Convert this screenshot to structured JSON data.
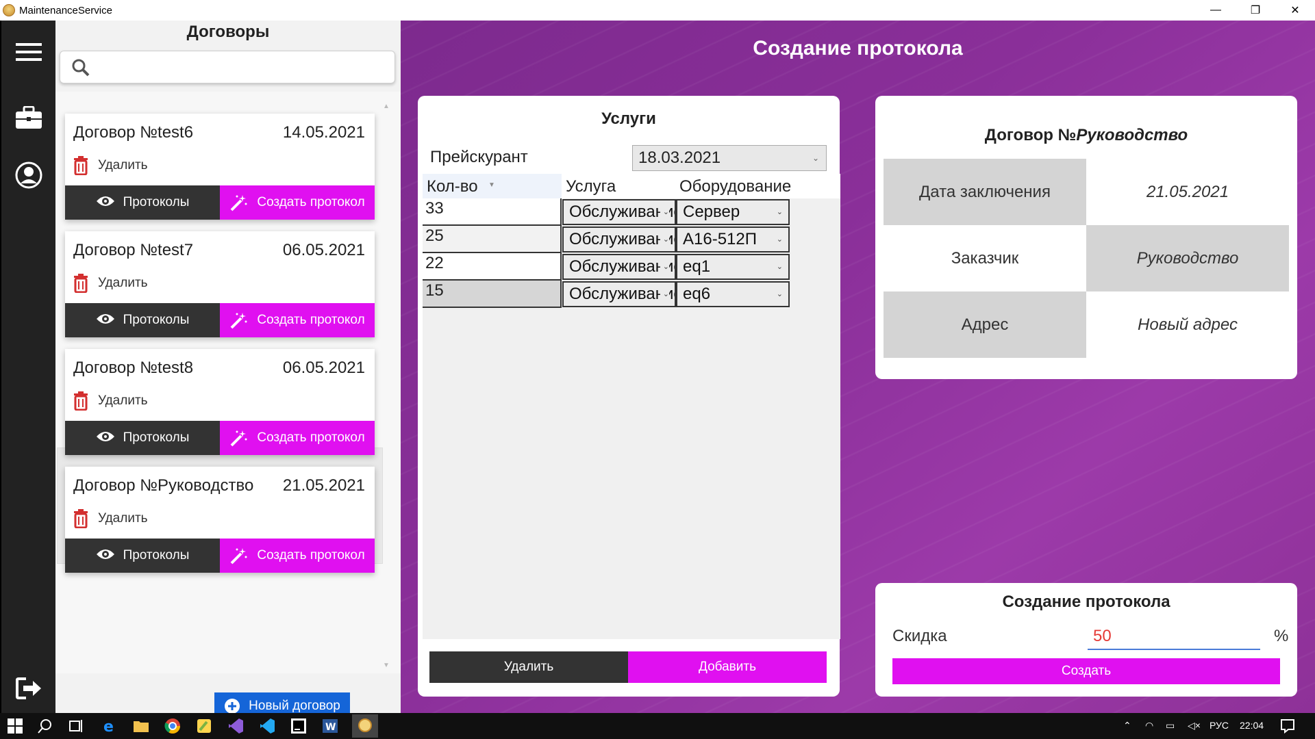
{
  "window": {
    "title": "MaintenanceService",
    "minimize": "—",
    "restore": "❐",
    "close": "✕"
  },
  "sidebar": {
    "menu_icon": "hamburger-icon",
    "briefcase_icon": "briefcase-icon",
    "user_icon": "user-icon",
    "logout_icon": "logout-icon"
  },
  "contracts": {
    "title": "Договоры",
    "search": {
      "value": "",
      "placeholder": ""
    },
    "delete_label": "Удалить",
    "protocols_label": "Протоколы",
    "create_protocol_label": "Создать протокол",
    "items": [
      {
        "title": "Договор №test6",
        "date": "14.05.2021"
      },
      {
        "title": "Договор №test7",
        "date": "06.05.2021"
      },
      {
        "title": "Договор №test8",
        "date": "06.05.2021"
      },
      {
        "title": "Договор №Руководство",
        "date": "21.05.2021"
      }
    ],
    "new_contract_label": "Новый договор"
  },
  "main": {
    "title": "Создание протокола",
    "services": {
      "title": "Услуги",
      "price_list_label": "Прейскурант",
      "price_list_value": "18.03.2021",
      "columns": [
        "Кол-во",
        "Услуга",
        "Оборудование"
      ],
      "rows": [
        {
          "qty": "33",
          "service": "Обслуживание",
          "equipment": "Сервер"
        },
        {
          "qty": "25",
          "service": "Обслуживание",
          "equipment": "А16-512П"
        },
        {
          "qty": "22",
          "service": "Обслуживание",
          "equipment": "eq1"
        },
        {
          "qty": "15",
          "service": "Обслуживание",
          "equipment": "eq6"
        }
      ],
      "delete_label": "Удалить",
      "add_label": "Добавить"
    },
    "contract_info": {
      "title_prefix": "Договор №",
      "title_name": "Руководство",
      "date_label": "Дата заключения",
      "date_value": "21.05.2021",
      "customer_label": "Заказчик",
      "customer_value": "Руководство",
      "address_label": "Адрес",
      "address_value": "Новый адрес"
    },
    "create_protocol": {
      "title": "Создание протокола",
      "discount_label": "Скидка",
      "discount_value": "50",
      "percent": "%",
      "create_label": "Создать"
    }
  },
  "taskbar": {
    "language": "РУС",
    "time": "22:04"
  },
  "colors": {
    "accent": "#e010f0",
    "dark": "#333333",
    "primary_blue": "#1565d8",
    "purple_bg": "#8a2f99"
  }
}
